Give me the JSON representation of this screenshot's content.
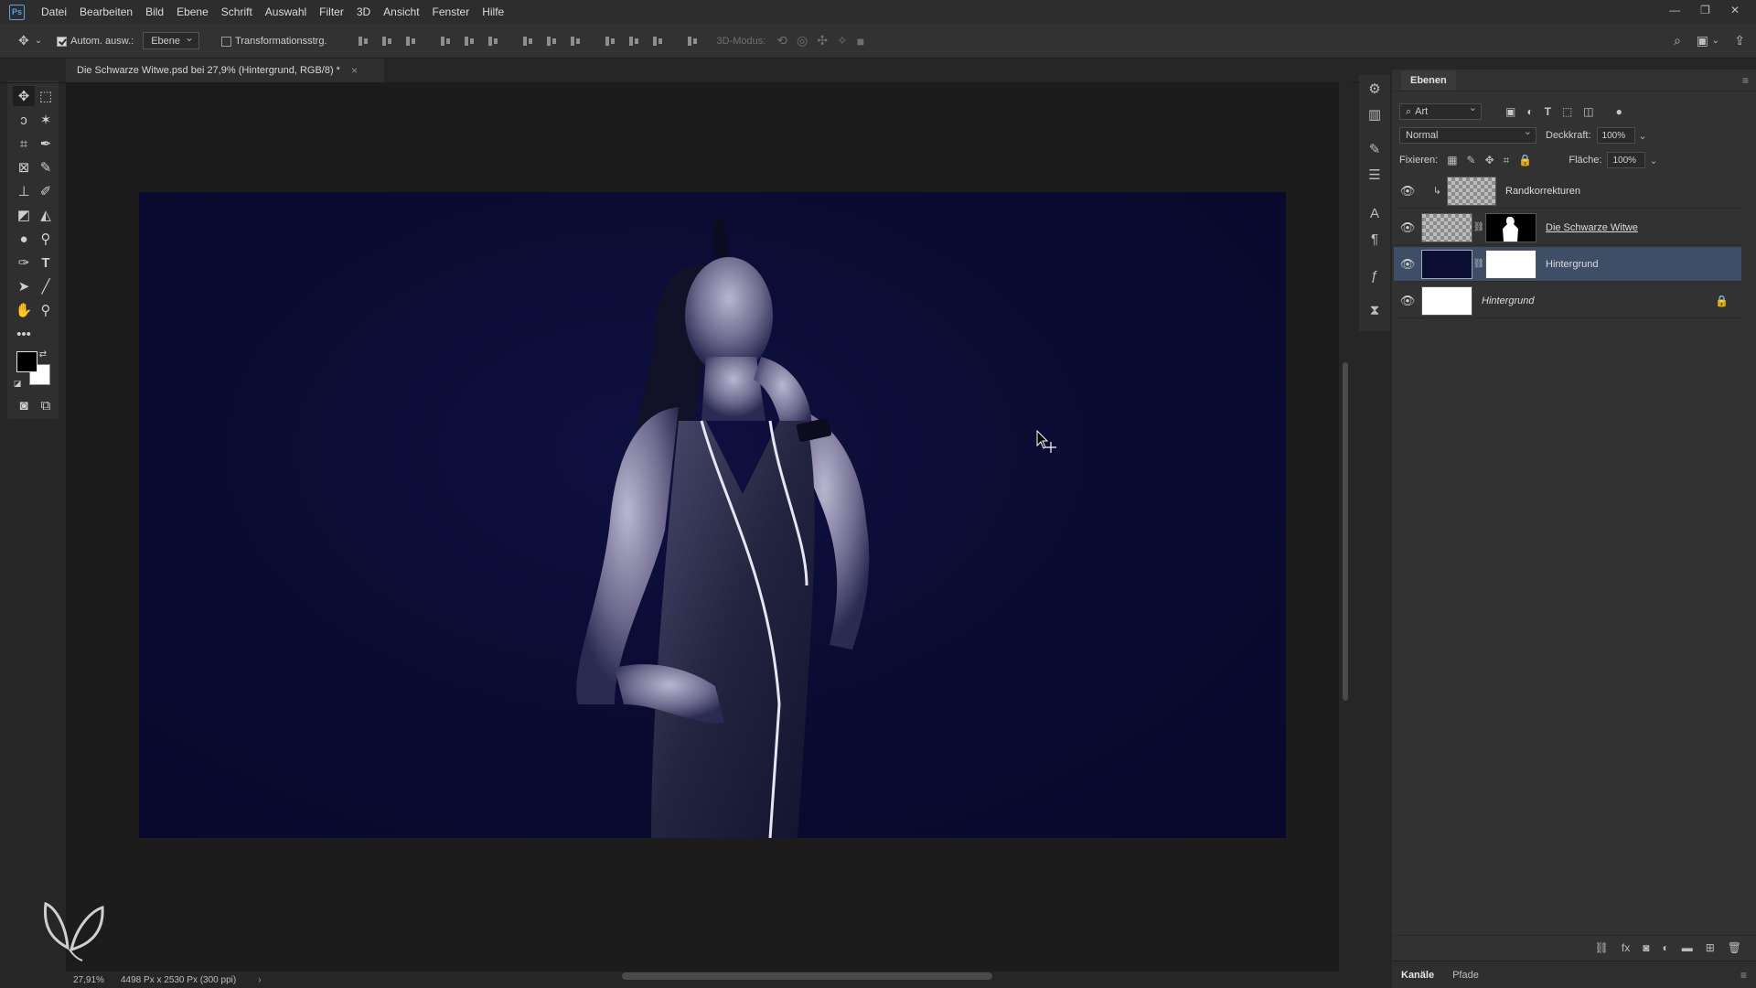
{
  "app": {
    "logo_text": "Ps",
    "menu": [
      "Datei",
      "Bearbeiten",
      "Bild",
      "Ebene",
      "Schrift",
      "Auswahl",
      "Filter",
      "3D",
      "Ansicht",
      "Fenster",
      "Hilfe"
    ]
  },
  "options_bar": {
    "auto_select_label": "Autom. ausw.:",
    "auto_select_target": "Ebene",
    "transform_label": "Transformationsstrg.",
    "mode_3d_label": "3D-Modus:"
  },
  "document": {
    "tab_title": "Die Schwarze Witwe.psd bei 27,9% (Hintergrund, RGB/8) *",
    "close_glyph": "×"
  },
  "status": {
    "zoom": "27,91%",
    "doc_size": "4498 Px x 2530 Px (300 ppi)",
    "arrow": "›"
  },
  "layers_panel": {
    "tab_label": "Ebenen",
    "filter_kind": "Art",
    "blend_mode": "Normal",
    "opacity_label": "Deckkraft:",
    "opacity_value": "100%",
    "lock_label": "Fixieren:",
    "fill_label": "Fläche:",
    "fill_value": "100%",
    "layers": [
      {
        "name": "Randkorrekturen",
        "visible": true,
        "clipped": true
      },
      {
        "name": "Die Schwarze Witwe",
        "visible": true,
        "has_mask": true
      },
      {
        "name": "Hintergrund",
        "visible": true,
        "has_mask": true,
        "selected": true
      },
      {
        "name": "Hintergrund",
        "visible": true,
        "locked": true
      }
    ]
  },
  "bottom_tabs": [
    "Kanäle",
    "Pfade"
  ],
  "colors": {
    "foreground": "#000000",
    "background": "#ffffff",
    "selection": "#3d4e66",
    "image_bg": "#0b0b33"
  }
}
